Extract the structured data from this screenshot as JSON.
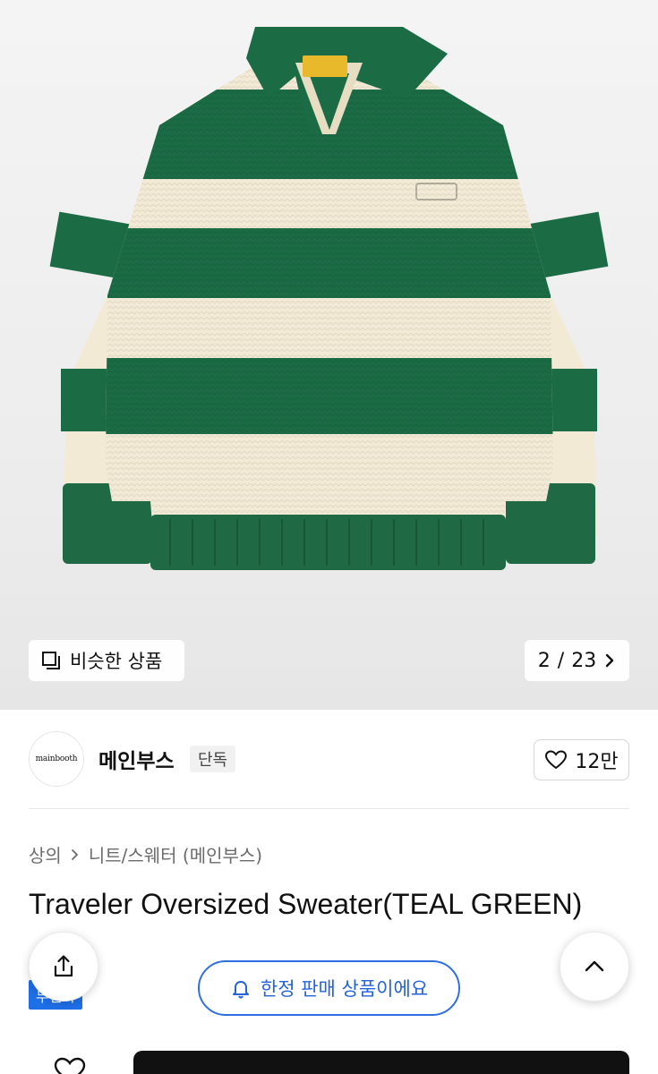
{
  "hero": {
    "logo_label": "mainbooth",
    "similar_label": "비슷한 상품",
    "pager": {
      "current": "2",
      "total": "23",
      "separator": "/"
    }
  },
  "brand": {
    "logo_text": "mainbooth",
    "name": "메인부스",
    "badge": "단독",
    "likes": "12만"
  },
  "breadcrumb": {
    "items": [
      "상의",
      "니트/스웨터 (메인부스)"
    ]
  },
  "product": {
    "title": "Traveler Oversized Sweater(TEAL GREEN)",
    "tag": "무신사"
  },
  "limited": {
    "label": "한정 판매 상품이에요"
  },
  "colors": {
    "teal_green": "#1b6b45",
    "cream": "#f2ead5",
    "accent_blue": "#2563d9",
    "tag_blue": "#1f6fe8"
  }
}
